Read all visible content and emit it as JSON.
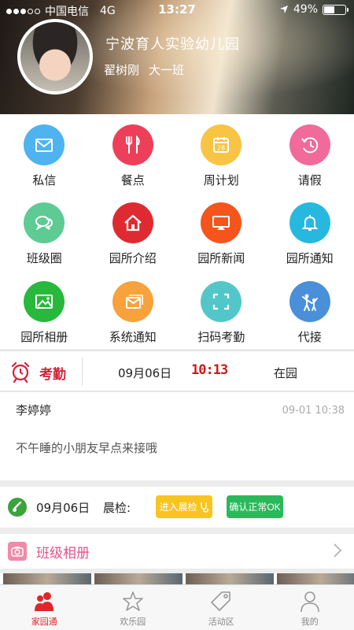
{
  "status_bar": {
    "carrier": "中国电信",
    "network": "4G",
    "time": "13:27",
    "battery": "49%",
    "battery_level": 0.49
  },
  "profile": {
    "school": "宁波育人实验幼儿园",
    "student_name": "翟树刚",
    "class_name": "大一班"
  },
  "menu": [
    {
      "label": "私信",
      "icon": "mail-icon",
      "color": "#4fb3f0"
    },
    {
      "label": "餐点",
      "icon": "cutlery-icon",
      "color": "#ee3f5a"
    },
    {
      "label": "周计划",
      "icon": "calendar-icon",
      "color": "#f7c443"
    },
    {
      "label": "请假",
      "icon": "clock-back-icon",
      "color": "#f06a9a"
    },
    {
      "label": "班级圈",
      "icon": "chat-bubbles-icon",
      "color": "#5ecb95"
    },
    {
      "label": "园所介绍",
      "icon": "home-icon",
      "color": "#e02a32"
    },
    {
      "label": "园所新闻",
      "icon": "screen-icon",
      "color": "#f5541c"
    },
    {
      "label": "园所通知",
      "icon": "bell-icon",
      "color": "#27b8e0"
    },
    {
      "label": "园所相册",
      "icon": "picture-icon",
      "color": "#27b83c"
    },
    {
      "label": "系统通知",
      "icon": "messages-icon",
      "color": "#f7a23a"
    },
    {
      "label": "扫码考勤",
      "icon": "scan-icon",
      "color": "#53c6c9"
    },
    {
      "label": "代接",
      "icon": "family-icon",
      "color": "#4a8fd9"
    }
  ],
  "attendance": {
    "label": "考勤",
    "date": "09月06日",
    "time": "10:13",
    "status": "在园"
  },
  "message": {
    "sender": "李婷婷",
    "time": "09-01 10:38",
    "text": "不午睡的小朋友早点来接哦"
  },
  "morning_check": {
    "date": "09月06日",
    "label": "晨检:",
    "enter_button": "进入晨检",
    "confirm_button": "确认正常OK"
  },
  "album": {
    "title": "班级相册"
  },
  "tabs": [
    {
      "label": "家园通",
      "icon": "people-icon",
      "active": true
    },
    {
      "label": "欢乐园",
      "icon": "star-icon",
      "active": false
    },
    {
      "label": "活动区",
      "icon": "tag-icon",
      "active": false
    },
    {
      "label": "我的",
      "icon": "person-icon",
      "active": false
    }
  ],
  "colors": {
    "accent_red": "#e0262b",
    "attendance_red": "#d4213a",
    "album_pink": "#e3508a"
  }
}
